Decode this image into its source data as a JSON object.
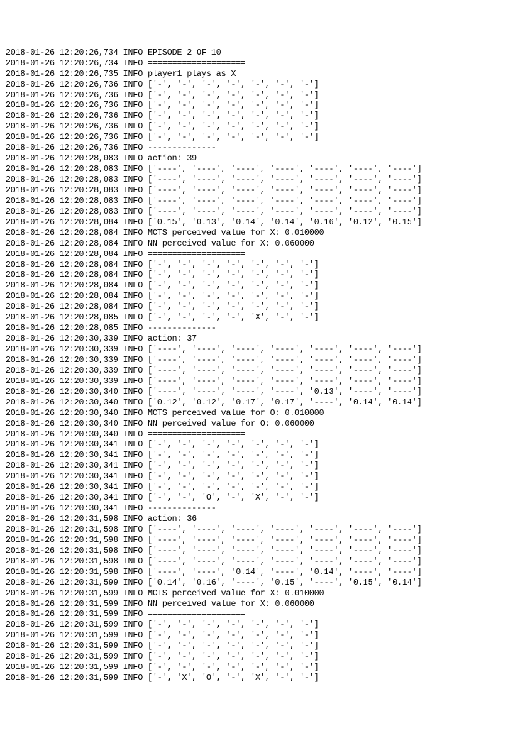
{
  "lines": [
    {
      "ts": "2018-01-26 12:20:26,734",
      "level": "INFO",
      "msg": "EPISODE 2 OF 10"
    },
    {
      "ts": "2018-01-26 12:20:26,734",
      "level": "INFO",
      "msg": "===================="
    },
    {
      "ts": "2018-01-26 12:20:26,735",
      "level": "INFO",
      "msg": "player1 plays as X"
    },
    {
      "ts": "2018-01-26 12:20:26,736",
      "level": "INFO",
      "msg": "['-', '-', '-', '-', '-', '-', '-']"
    },
    {
      "ts": "2018-01-26 12:20:26,736",
      "level": "INFO",
      "msg": "['-', '-', '-', '-', '-', '-', '-']"
    },
    {
      "ts": "2018-01-26 12:20:26,736",
      "level": "INFO",
      "msg": "['-', '-', '-', '-', '-', '-', '-']"
    },
    {
      "ts": "2018-01-26 12:20:26,736",
      "level": "INFO",
      "msg": "['-', '-', '-', '-', '-', '-', '-']"
    },
    {
      "ts": "2018-01-26 12:20:26,736",
      "level": "INFO",
      "msg": "['-', '-', '-', '-', '-', '-', '-']"
    },
    {
      "ts": "2018-01-26 12:20:26,736",
      "level": "INFO",
      "msg": "['-', '-', '-', '-', '-', '-', '-']"
    },
    {
      "ts": "2018-01-26 12:20:26,736",
      "level": "INFO",
      "msg": "--------------"
    },
    {
      "ts": "2018-01-26 12:20:28,083",
      "level": "INFO",
      "msg": "action: 39"
    },
    {
      "ts": "2018-01-26 12:20:28,083",
      "level": "INFO",
      "msg": "['----', '----', '----', '----', '----', '----', '----']"
    },
    {
      "ts": "2018-01-26 12:20:28,083",
      "level": "INFO",
      "msg": "['----', '----', '----', '----', '----', '----', '----']"
    },
    {
      "ts": "2018-01-26 12:20:28,083",
      "level": "INFO",
      "msg": "['----', '----', '----', '----', '----', '----', '----']"
    },
    {
      "ts": "2018-01-26 12:20:28,083",
      "level": "INFO",
      "msg": "['----', '----', '----', '----', '----', '----', '----']"
    },
    {
      "ts": "2018-01-26 12:20:28,083",
      "level": "INFO",
      "msg": "['----', '----', '----', '----', '----', '----', '----']"
    },
    {
      "ts": "2018-01-26 12:20:28,084",
      "level": "INFO",
      "msg": "['0.15', '0.13', '0.14', '0.14', '0.16', '0.12', '0.15']"
    },
    {
      "ts": "2018-01-26 12:20:28,084",
      "level": "INFO",
      "msg": "MCTS perceived value for X: 0.010000"
    },
    {
      "ts": "2018-01-26 12:20:28,084",
      "level": "INFO",
      "msg": "NN perceived value for X: 0.060000"
    },
    {
      "ts": "2018-01-26 12:20:28,084",
      "level": "INFO",
      "msg": "===================="
    },
    {
      "ts": "2018-01-26 12:20:28,084",
      "level": "INFO",
      "msg": "['-', '-', '-', '-', '-', '-', '-']"
    },
    {
      "ts": "2018-01-26 12:20:28,084",
      "level": "INFO",
      "msg": "['-', '-', '-', '-', '-', '-', '-']"
    },
    {
      "ts": "2018-01-26 12:20:28,084",
      "level": "INFO",
      "msg": "['-', '-', '-', '-', '-', '-', '-']"
    },
    {
      "ts": "2018-01-26 12:20:28,084",
      "level": "INFO",
      "msg": "['-', '-', '-', '-', '-', '-', '-']"
    },
    {
      "ts": "2018-01-26 12:20:28,084",
      "level": "INFO",
      "msg": "['-', '-', '-', '-', '-', '-', '-']"
    },
    {
      "ts": "2018-01-26 12:20:28,085",
      "level": "INFO",
      "msg": "['-', '-', '-', '-', 'X', '-', '-']"
    },
    {
      "ts": "2018-01-26 12:20:28,085",
      "level": "INFO",
      "msg": "--------------"
    },
    {
      "ts": "2018-01-26 12:20:30,339",
      "level": "INFO",
      "msg": "action: 37"
    },
    {
      "ts": "2018-01-26 12:20:30,339",
      "level": "INFO",
      "msg": "['----', '----', '----', '----', '----', '----', '----']"
    },
    {
      "ts": "2018-01-26 12:20:30,339",
      "level": "INFO",
      "msg": "['----', '----', '----', '----', '----', '----', '----']"
    },
    {
      "ts": "2018-01-26 12:20:30,339",
      "level": "INFO",
      "msg": "['----', '----', '----', '----', '----', '----', '----']"
    },
    {
      "ts": "2018-01-26 12:20:30,339",
      "level": "INFO",
      "msg": "['----', '----', '----', '----', '----', '----', '----']"
    },
    {
      "ts": "2018-01-26 12:20:30,340",
      "level": "INFO",
      "msg": "['----', '----', '----', '----', '0.13', '----', '----']"
    },
    {
      "ts": "2018-01-26 12:20:30,340",
      "level": "INFO",
      "msg": "['0.12', '0.12', '0.17', '0.17', '----', '0.14', '0.14']"
    },
    {
      "ts": "2018-01-26 12:20:30,340",
      "level": "INFO",
      "msg": "MCTS perceived value for O: 0.010000"
    },
    {
      "ts": "2018-01-26 12:20:30,340",
      "level": "INFO",
      "msg": "NN perceived value for O: 0.060000"
    },
    {
      "ts": "2018-01-26 12:20:30,340",
      "level": "INFO",
      "msg": "===================="
    },
    {
      "ts": "2018-01-26 12:20:30,341",
      "level": "INFO",
      "msg": "['-', '-', '-', '-', '-', '-', '-']"
    },
    {
      "ts": "2018-01-26 12:20:30,341",
      "level": "INFO",
      "msg": "['-', '-', '-', '-', '-', '-', '-']"
    },
    {
      "ts": "2018-01-26 12:20:30,341",
      "level": "INFO",
      "msg": "['-', '-', '-', '-', '-', '-', '-']"
    },
    {
      "ts": "2018-01-26 12:20:30,341",
      "level": "INFO",
      "msg": "['-', '-', '-', '-', '-', '-', '-']"
    },
    {
      "ts": "2018-01-26 12:20:30,341",
      "level": "INFO",
      "msg": "['-', '-', '-', '-', '-', '-', '-']"
    },
    {
      "ts": "2018-01-26 12:20:30,341",
      "level": "INFO",
      "msg": "['-', '-', 'O', '-', 'X', '-', '-']"
    },
    {
      "ts": "2018-01-26 12:20:30,341",
      "level": "INFO",
      "msg": "--------------"
    },
    {
      "ts": "2018-01-26 12:20:31,598",
      "level": "INFO",
      "msg": "action: 36"
    },
    {
      "ts": "2018-01-26 12:20:31,598",
      "level": "INFO",
      "msg": "['----', '----', '----', '----', '----', '----', '----']"
    },
    {
      "ts": "2018-01-26 12:20:31,598",
      "level": "INFO",
      "msg": "['----', '----', '----', '----', '----', '----', '----']"
    },
    {
      "ts": "2018-01-26 12:20:31,598",
      "level": "INFO",
      "msg": "['----', '----', '----', '----', '----', '----', '----']"
    },
    {
      "ts": "2018-01-26 12:20:31,598",
      "level": "INFO",
      "msg": "['----', '----', '----', '----', '----', '----', '----']"
    },
    {
      "ts": "2018-01-26 12:20:31,598",
      "level": "INFO",
      "msg": "['----', '----', '0.14', '----', '0.14', '----', '----']"
    },
    {
      "ts": "2018-01-26 12:20:31,599",
      "level": "INFO",
      "msg": "['0.14', '0.16', '----', '0.15', '----', '0.15', '0.14']"
    },
    {
      "ts": "2018-01-26 12:20:31,599",
      "level": "INFO",
      "msg": "MCTS perceived value for X: 0.010000"
    },
    {
      "ts": "2018-01-26 12:20:31,599",
      "level": "INFO",
      "msg": "NN perceived value for X: 0.060000"
    },
    {
      "ts": "2018-01-26 12:20:31,599",
      "level": "INFO",
      "msg": "===================="
    },
    {
      "ts": "2018-01-26 12:20:31,599",
      "level": "INFO",
      "msg": "['-', '-', '-', '-', '-', '-', '-']"
    },
    {
      "ts": "2018-01-26 12:20:31,599",
      "level": "INFO",
      "msg": "['-', '-', '-', '-', '-', '-', '-']"
    },
    {
      "ts": "2018-01-26 12:20:31,599",
      "level": "INFO",
      "msg": "['-', '-', '-', '-', '-', '-', '-']"
    },
    {
      "ts": "2018-01-26 12:20:31,599",
      "level": "INFO",
      "msg": "['-', '-', '-', '-', '-', '-', '-']"
    },
    {
      "ts": "2018-01-26 12:20:31,599",
      "level": "INFO",
      "msg": "['-', '-', '-', '-', '-', '-', '-']"
    },
    {
      "ts": "2018-01-26 12:20:31,599",
      "level": "INFO",
      "msg": "['-', 'X', 'O', '-', 'X', '-', '-']"
    }
  ]
}
